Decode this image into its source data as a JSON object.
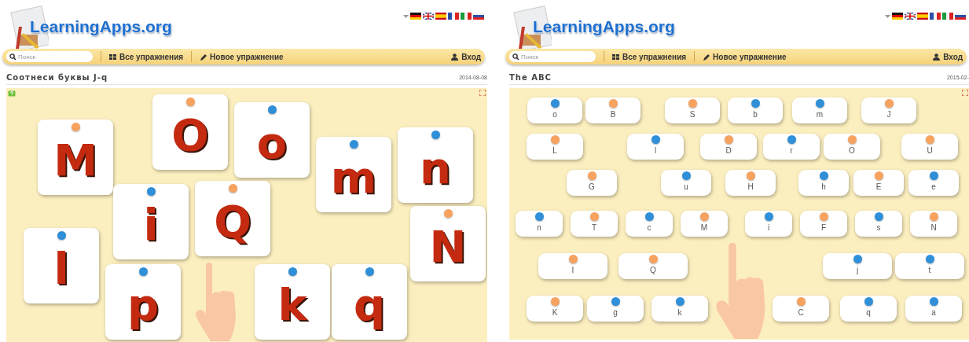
{
  "panels": [
    {
      "logo_text": "LearningApps.org",
      "search": {
        "placeholder": "Поиск"
      },
      "menu": [
        {
          "kind": "grid",
          "label": "Все упражнения"
        },
        {
          "kind": "pencil",
          "label": "Новое упражнение"
        }
      ],
      "login": "Вход",
      "title": "Соотнеси буквы J-q",
      "date": "2014-08-08",
      "game": {
        "kind": "picture-tiles",
        "cards": [
          {
            "letter": "M",
            "color": "#f7a25e"
          },
          {
            "letter": "O",
            "color": "#f7a25e"
          },
          {
            "letter": "o",
            "color": "#2f8fd8"
          },
          {
            "letter": "m",
            "color": "#2f8fd8"
          },
          {
            "letter": "n",
            "color": "#2f8fd8"
          },
          {
            "letter": "i",
            "color": "#2f8fd8"
          },
          {
            "letter": "Q",
            "color": "#f7a25e"
          },
          {
            "letter": "N",
            "color": "#f7a25e"
          },
          {
            "letter": "l",
            "color": "#2f8fd8"
          },
          {
            "letter": "p",
            "color": "#2f8fd8"
          },
          {
            "letter": "k",
            "color": "#2f8fd8"
          },
          {
            "letter": "q",
            "color": "#2f8fd8"
          }
        ]
      }
    },
    {
      "logo_text": "LearningApps.org",
      "search": {
        "placeholder": "Поиск"
      },
      "menu": [
        {
          "kind": "grid",
          "label": "Все упражнения"
        },
        {
          "kind": "pencil",
          "label": "Новое упражнение"
        }
      ],
      "login": "Вход",
      "title": "The ABC",
      "date": "2015-02-",
      "game": {
        "kind": "word-tiles",
        "cards": [
          {
            "letter": "o",
            "color": "#2f8fd8"
          },
          {
            "letter": "B",
            "color": "#f7a25e"
          },
          {
            "letter": "S",
            "color": "#f7a25e"
          },
          {
            "letter": "b",
            "color": "#2f8fd8"
          },
          {
            "letter": "m",
            "color": "#2f8fd8"
          },
          {
            "letter": "J",
            "color": "#f7a25e"
          },
          {
            "letter": "L",
            "color": "#f7a25e"
          },
          {
            "letter": "l",
            "color": "#2f8fd8"
          },
          {
            "letter": "D",
            "color": "#f7a25e"
          },
          {
            "letter": "r",
            "color": "#2f8fd8"
          },
          {
            "letter": "O",
            "color": "#f7a25e"
          },
          {
            "letter": "U",
            "color": "#f7a25e"
          },
          {
            "letter": "G",
            "color": "#f7a25e"
          },
          {
            "letter": "u",
            "color": "#2f8fd8"
          },
          {
            "letter": "H",
            "color": "#f7a25e"
          },
          {
            "letter": "h",
            "color": "#2f8fd8"
          },
          {
            "letter": "E",
            "color": "#f7a25e"
          },
          {
            "letter": "e",
            "color": "#2f8fd8"
          },
          {
            "letter": "n",
            "color": "#2f8fd8"
          },
          {
            "letter": "T",
            "color": "#f7a25e"
          },
          {
            "letter": "c",
            "color": "#2f8fd8"
          },
          {
            "letter": "M",
            "color": "#f7a25e"
          },
          {
            "letter": "i",
            "color": "#2f8fd8"
          },
          {
            "letter": "F",
            "color": "#f7a25e"
          },
          {
            "letter": "s",
            "color": "#2f8fd8"
          },
          {
            "letter": "N",
            "color": "#f7a25e"
          },
          {
            "letter": "I",
            "color": "#f7a25e"
          },
          {
            "letter": "Q",
            "color": "#f7a25e"
          },
          {
            "letter": "j",
            "color": "#2f8fd8"
          },
          {
            "letter": "t",
            "color": "#2f8fd8"
          },
          {
            "letter": "K",
            "color": "#f7a25e"
          },
          {
            "letter": "g",
            "color": "#2f8fd8"
          },
          {
            "letter": "k",
            "color": "#2f8fd8"
          },
          {
            "letter": "C",
            "color": "#f7a25e"
          },
          {
            "letter": "q",
            "color": "#2f8fd8"
          },
          {
            "letter": "a",
            "color": "#2f8fd8"
          }
        ]
      }
    }
  ]
}
